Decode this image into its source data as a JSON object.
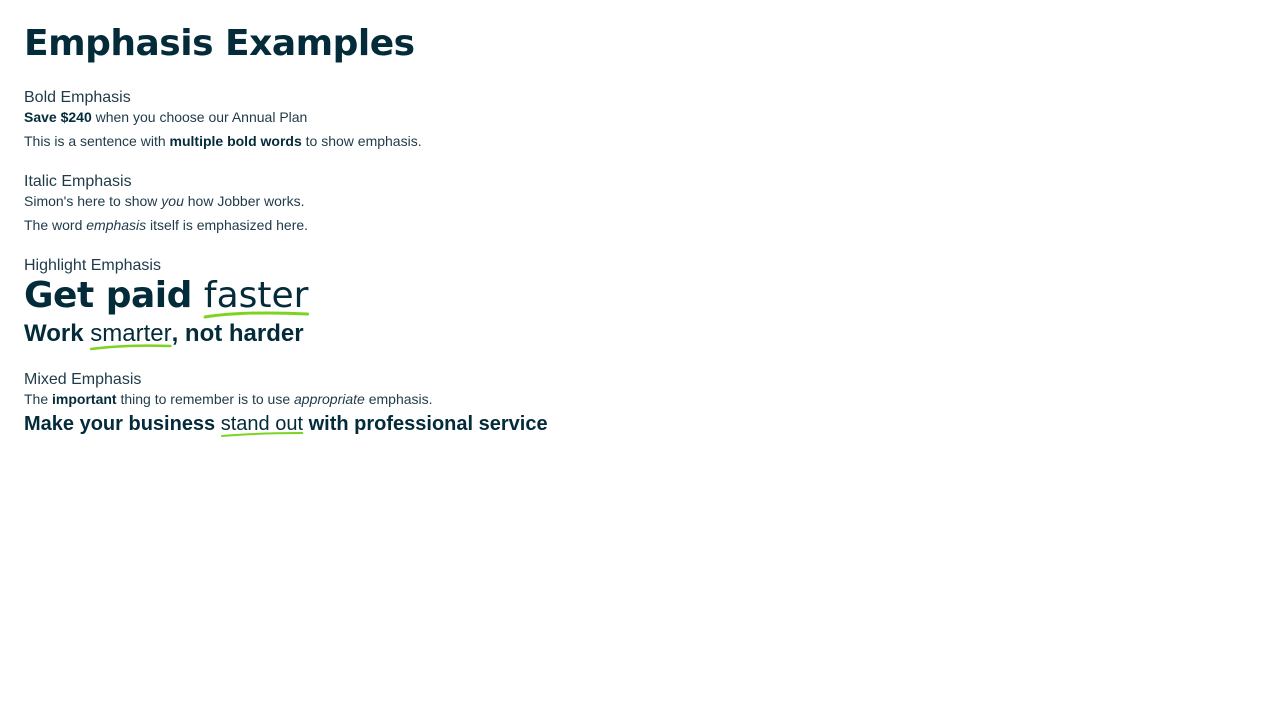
{
  "page": {
    "title": "Emphasis Examples"
  },
  "colors": {
    "text": "#032b3a",
    "highlight": "#7ed321"
  },
  "sections": {
    "bold": {
      "heading": "Bold Emphasis",
      "line1": {
        "strong": "Save $240",
        "rest": " when you choose our Annual Plan"
      },
      "line2": {
        "before": "This is a sentence with ",
        "strong": "multiple bold words",
        "after": " to show emphasis."
      }
    },
    "italic": {
      "heading": "Italic Emphasis",
      "line1": {
        "before": "Simon's here to show ",
        "em": "you",
        "after": " how Jobber works."
      },
      "line2": {
        "before": "The word ",
        "em": "emphasis",
        "after": " itself is emphasized here."
      }
    },
    "highlight": {
      "heading": "Highlight Emphasis",
      "line1": {
        "before": "Get paid ",
        "highlight": "faster"
      },
      "line2": {
        "before": "Work ",
        "highlight": "smarter",
        "after": ", not harder"
      }
    },
    "mixed": {
      "heading": "Mixed Emphasis",
      "line1": {
        "before": "The ",
        "strong": "important",
        "middle": " thing to remember is to use ",
        "em": "appropriate",
        "after": " emphasis."
      },
      "line2": {
        "before": "Make your business ",
        "highlight": "stand out",
        "after": " with professional service"
      }
    }
  }
}
